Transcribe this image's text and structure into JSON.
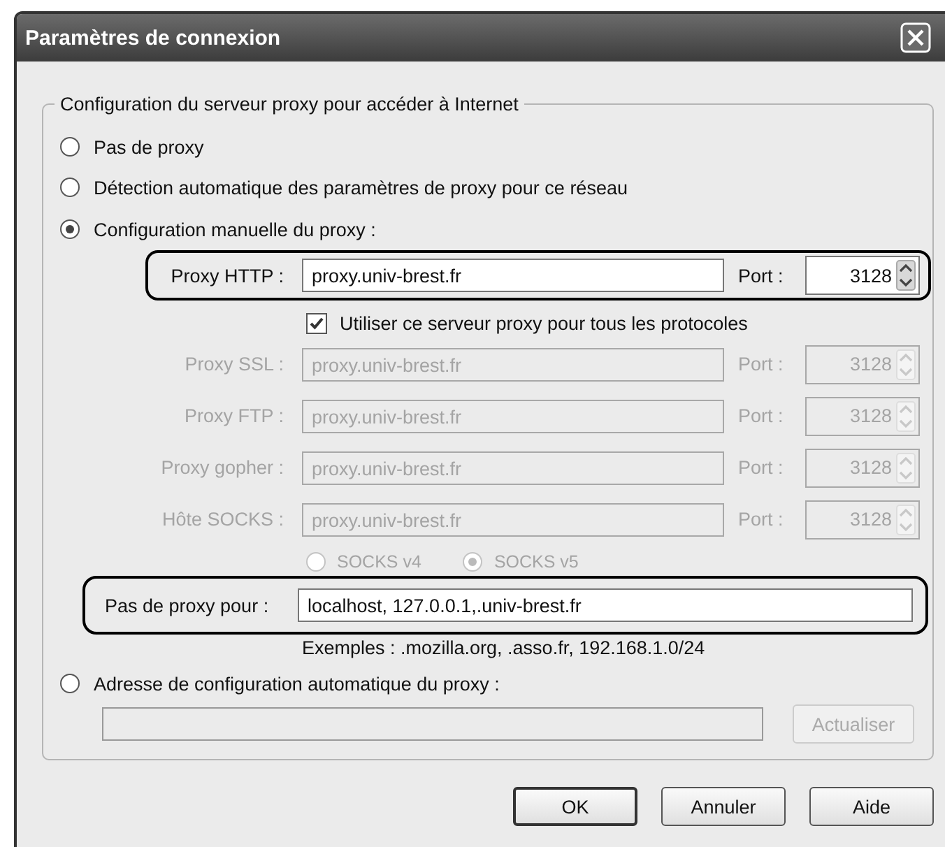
{
  "window": {
    "title": "Paramètres de connexion"
  },
  "group": {
    "legend": "Configuration du serveur proxy pour accéder à Internet"
  },
  "no_proxy_option": {
    "label": "Pas de proxy",
    "selected": false
  },
  "auto_detect_option": {
    "label": "Détection automatique des paramètres de proxy pour ce réseau",
    "selected": false
  },
  "manual_option": {
    "label": "Configuration manuelle du proxy :",
    "selected": true
  },
  "http_proxy": {
    "label": "Proxy HTTP :",
    "value": "proxy.univ-brest.fr",
    "port_label": "Port :",
    "port": "3128",
    "disabled": false,
    "outlined": true
  },
  "share_all": {
    "label": "Utiliser ce serveur proxy pour tous les protocoles",
    "checked": true
  },
  "proxies": [
    {
      "label": "Proxy SSL :",
      "value": "proxy.univ-brest.fr",
      "port_label": "Port :",
      "port": "3128",
      "disabled": true,
      "outlined": false
    },
    {
      "label": "Proxy FTP :",
      "value": "proxy.univ-brest.fr",
      "port_label": "Port :",
      "port": "3128",
      "disabled": true,
      "outlined": false
    },
    {
      "label": "Proxy gopher :",
      "value": "proxy.univ-brest.fr",
      "port_label": "Port :",
      "port": "3128",
      "disabled": true,
      "outlined": false
    },
    {
      "label": "Hôte SOCKS :",
      "value": "proxy.univ-brest.fr",
      "port_label": "Port :",
      "port": "3128",
      "disabled": true,
      "outlined": false
    }
  ],
  "socks_versions": [
    {
      "label": "SOCKS v4",
      "selected": false,
      "disabled": true
    },
    {
      "label": "SOCKS v5",
      "selected": true,
      "disabled": true
    }
  ],
  "no_proxy_for": {
    "label": "Pas de proxy pour :",
    "value": "localhost, 127.0.0.1,.univ-brest.fr",
    "outlined": true
  },
  "examples": "Exemples : .mozilla.org, .asso.fr, 192.168.1.0/24",
  "auto_config_option": {
    "label": "Adresse de configuration automatique du proxy :",
    "selected": false
  },
  "reload_button": {
    "label": "Actualiser",
    "disabled": true
  },
  "buttons": [
    {
      "label": "OK",
      "default": true
    },
    {
      "label": "Annuler",
      "default": false
    },
    {
      "label": "Aide",
      "default": false
    }
  ]
}
